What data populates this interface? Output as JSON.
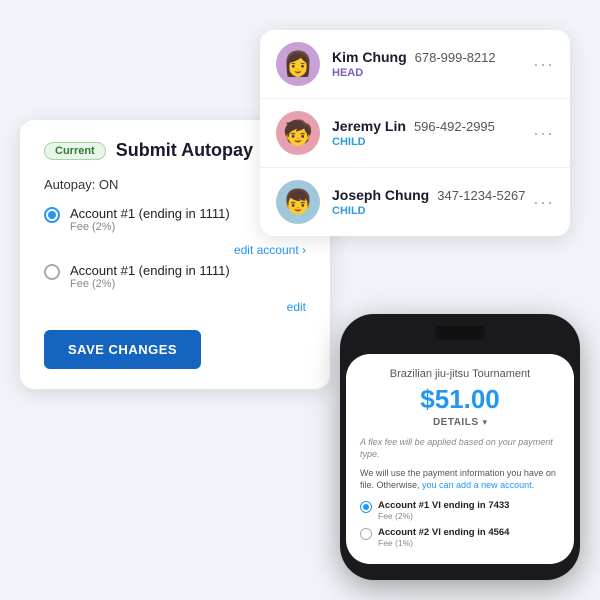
{
  "members": [
    {
      "name": "Kim Chung",
      "phone": "678-999-8212",
      "role": "HEAD",
      "avatarEmoji": "👩",
      "avatarColor": "#c8a0d8",
      "roleClass": "role-head"
    },
    {
      "name": "Jeremy Lin",
      "phone": "596-492-2995",
      "role": "CHILD",
      "avatarEmoji": "🧒",
      "avatarColor": "#e8a0b0",
      "roleClass": "role-child"
    },
    {
      "name": "Joseph Chung",
      "phone": "347-1234-5267",
      "role": "CHILD",
      "avatarEmoji": "👦",
      "avatarColor": "#a0c8d8",
      "roleClass": "role-child"
    }
  ],
  "autopay": {
    "badge": "Current",
    "title": "Submit Autopay",
    "status": "Autopay: ON",
    "accounts": [
      {
        "label": "Account #1 (ending in 1111)",
        "fee": "Fee (2%)",
        "selected": true
      },
      {
        "label": "Account #1 (ending in 1111)",
        "fee": "Fee (2%)",
        "selected": false
      }
    ],
    "edit_label": "edit account ›",
    "edit_label2": "edit",
    "save_btn": "SAVE CHANGES"
  },
  "payment": {
    "event": "Brazilian jiu-jitsu Tournament",
    "amount": "$51.00",
    "details_label": "DETAILS",
    "flex_note": "A flex fee will be applied based on your payment type.",
    "info_text": "We will use the payment information you have on file. Otherwise, you can add a new account.",
    "accounts": [
      {
        "label": "Account #1",
        "ending": "VI ending in 7433",
        "fee": "Fee (2%)",
        "selected": true
      },
      {
        "label": "Account #2",
        "ending": "VI ending in 4564",
        "fee": "Fee (1%)",
        "selected": false
      }
    ]
  }
}
